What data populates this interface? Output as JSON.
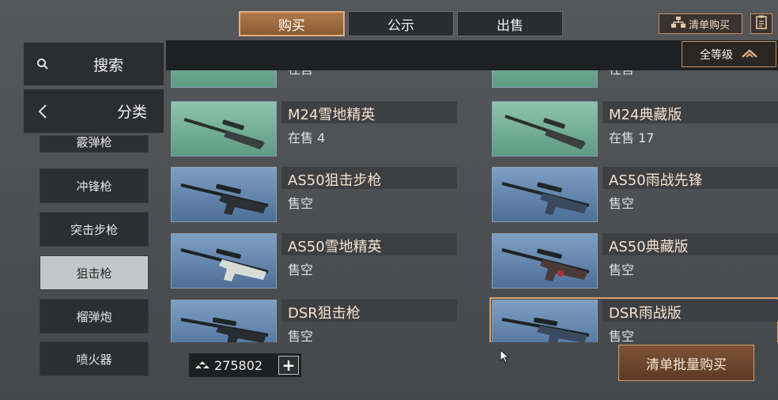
{
  "tabs": [
    {
      "label": "购买",
      "active": true
    },
    {
      "label": "公示",
      "active": false
    },
    {
      "label": "出售",
      "active": false
    }
  ],
  "header": {
    "list_buy_label": "清单购买",
    "grade_filter": "全等级"
  },
  "sidebar": {
    "search_label": "搜索",
    "category_label": "分类",
    "items": [
      {
        "label": "霰弹枪"
      },
      {
        "label": "冲锋枪"
      },
      {
        "label": "突击步枪"
      },
      {
        "label": "狙击枪",
        "active": true
      },
      {
        "label": "榴弹炮"
      },
      {
        "label": "喷火器"
      }
    ]
  },
  "items": [
    {
      "name": "",
      "status": "在售"
    },
    {
      "name": "",
      "status": "在售"
    },
    {
      "name": "M24雪地精英",
      "status": "在售 4"
    },
    {
      "name": "M24典藏版",
      "status": "在售 17"
    },
    {
      "name": "AS50狙击步枪",
      "status": "售空"
    },
    {
      "name": "AS50雨战先锋",
      "status": "售空"
    },
    {
      "name": "AS50雪地精英",
      "status": "售空"
    },
    {
      "name": "AS50典藏版",
      "status": "售空"
    },
    {
      "name": "DSR狙击枪",
      "status": "售空"
    },
    {
      "name": "DSR雨战版",
      "status": "售空",
      "selected": true
    }
  ],
  "footer": {
    "currency_amount": "275802",
    "batch_buy_label": "清单批量购买"
  },
  "colors": {
    "accent": "#d9a06a",
    "tab_active": "#9a6a3e",
    "thumb_green": "#7cb59c",
    "thumb_blue": "#6a8cb4"
  }
}
